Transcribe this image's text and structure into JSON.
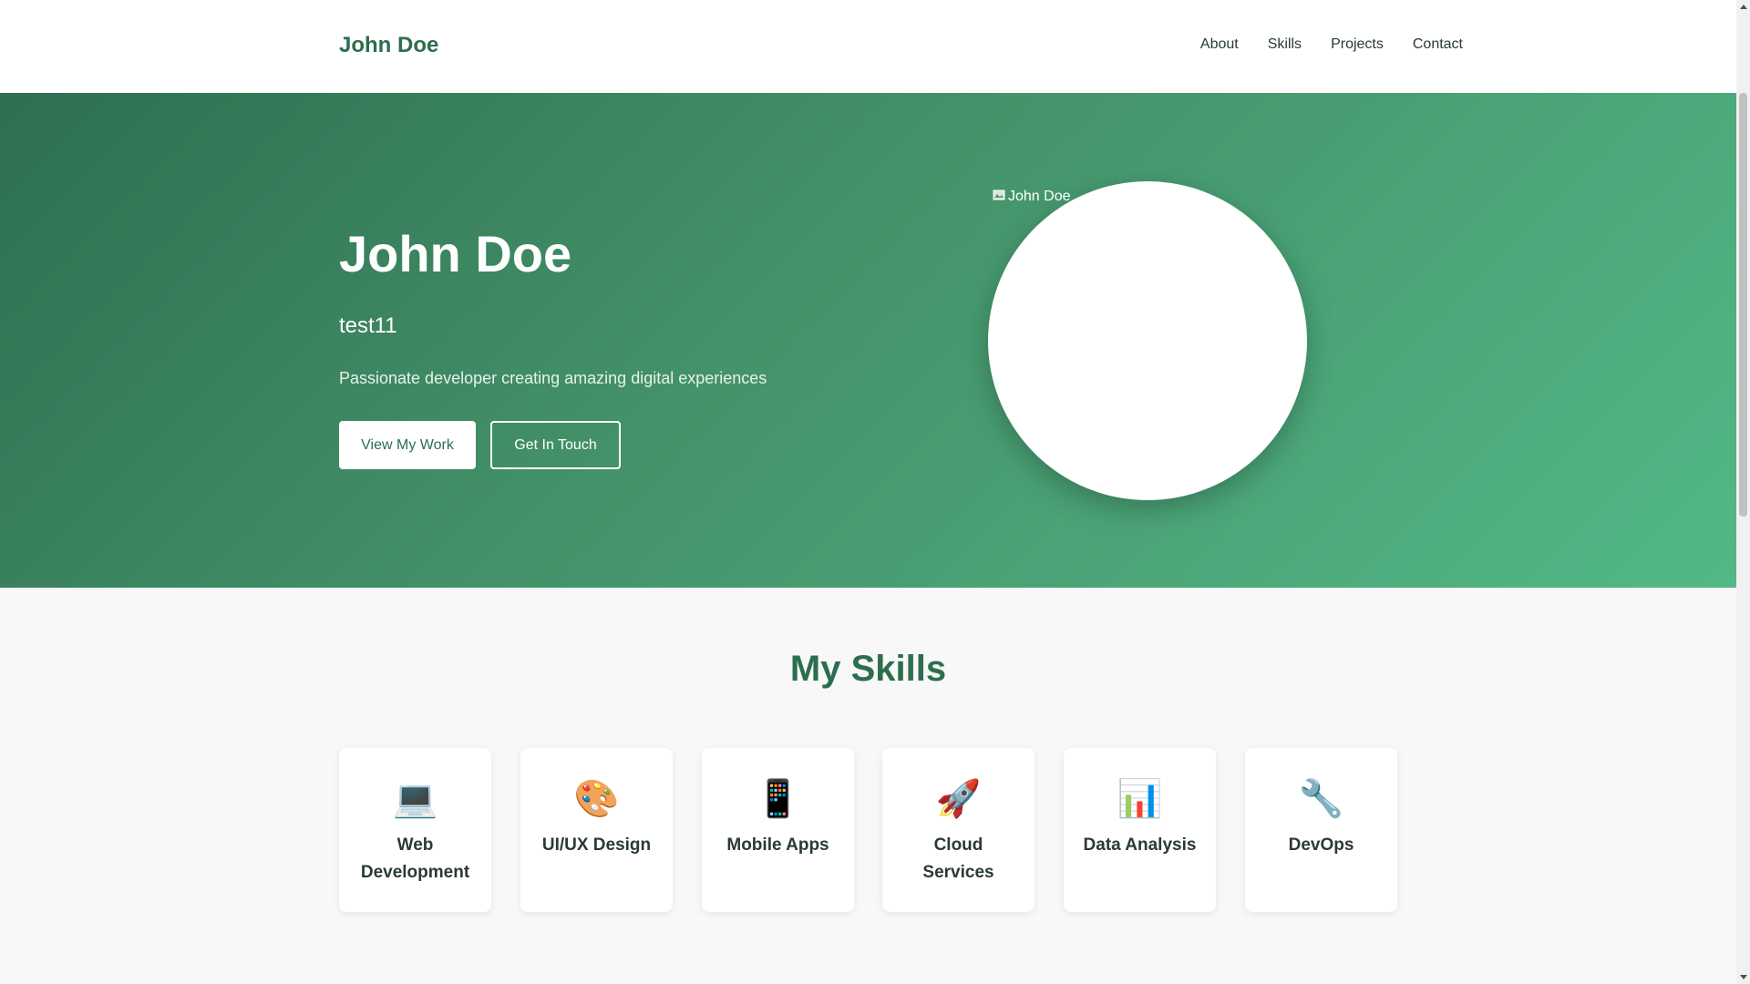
{
  "header": {
    "logo": "John Doe",
    "nav": [
      "About",
      "Skills",
      "Projects",
      "Contact"
    ]
  },
  "hero": {
    "name": "John Doe",
    "subtitle": "test11",
    "tagline": "Passionate developer creating amazing digital experiences",
    "primary_button": "View My Work",
    "secondary_button": "Get In Touch",
    "avatar_alt": "John Doe"
  },
  "skills": {
    "title": "My Skills",
    "items": [
      {
        "icon": "💻",
        "icon_name": "laptop-icon",
        "label": "Web Development"
      },
      {
        "icon": "🎨",
        "icon_name": "palette-icon",
        "label": "UI/UX Design"
      },
      {
        "icon": "📱",
        "icon_name": "mobile-phone-icon",
        "label": "Mobile Apps"
      },
      {
        "icon": "🚀",
        "icon_name": "rocket-icon",
        "label": "Cloud Services"
      },
      {
        "icon": "📊",
        "icon_name": "bar-chart-icon",
        "label": "Data Analysis"
      },
      {
        "icon": "🔧",
        "icon_name": "wrench-icon",
        "label": "DevOps"
      }
    ]
  },
  "colors": {
    "brand": "#2c6e4e",
    "hero_gradient_start": "#2e6f50",
    "hero_gradient_end": "#52b886",
    "text_dark": "#2b3a33"
  }
}
